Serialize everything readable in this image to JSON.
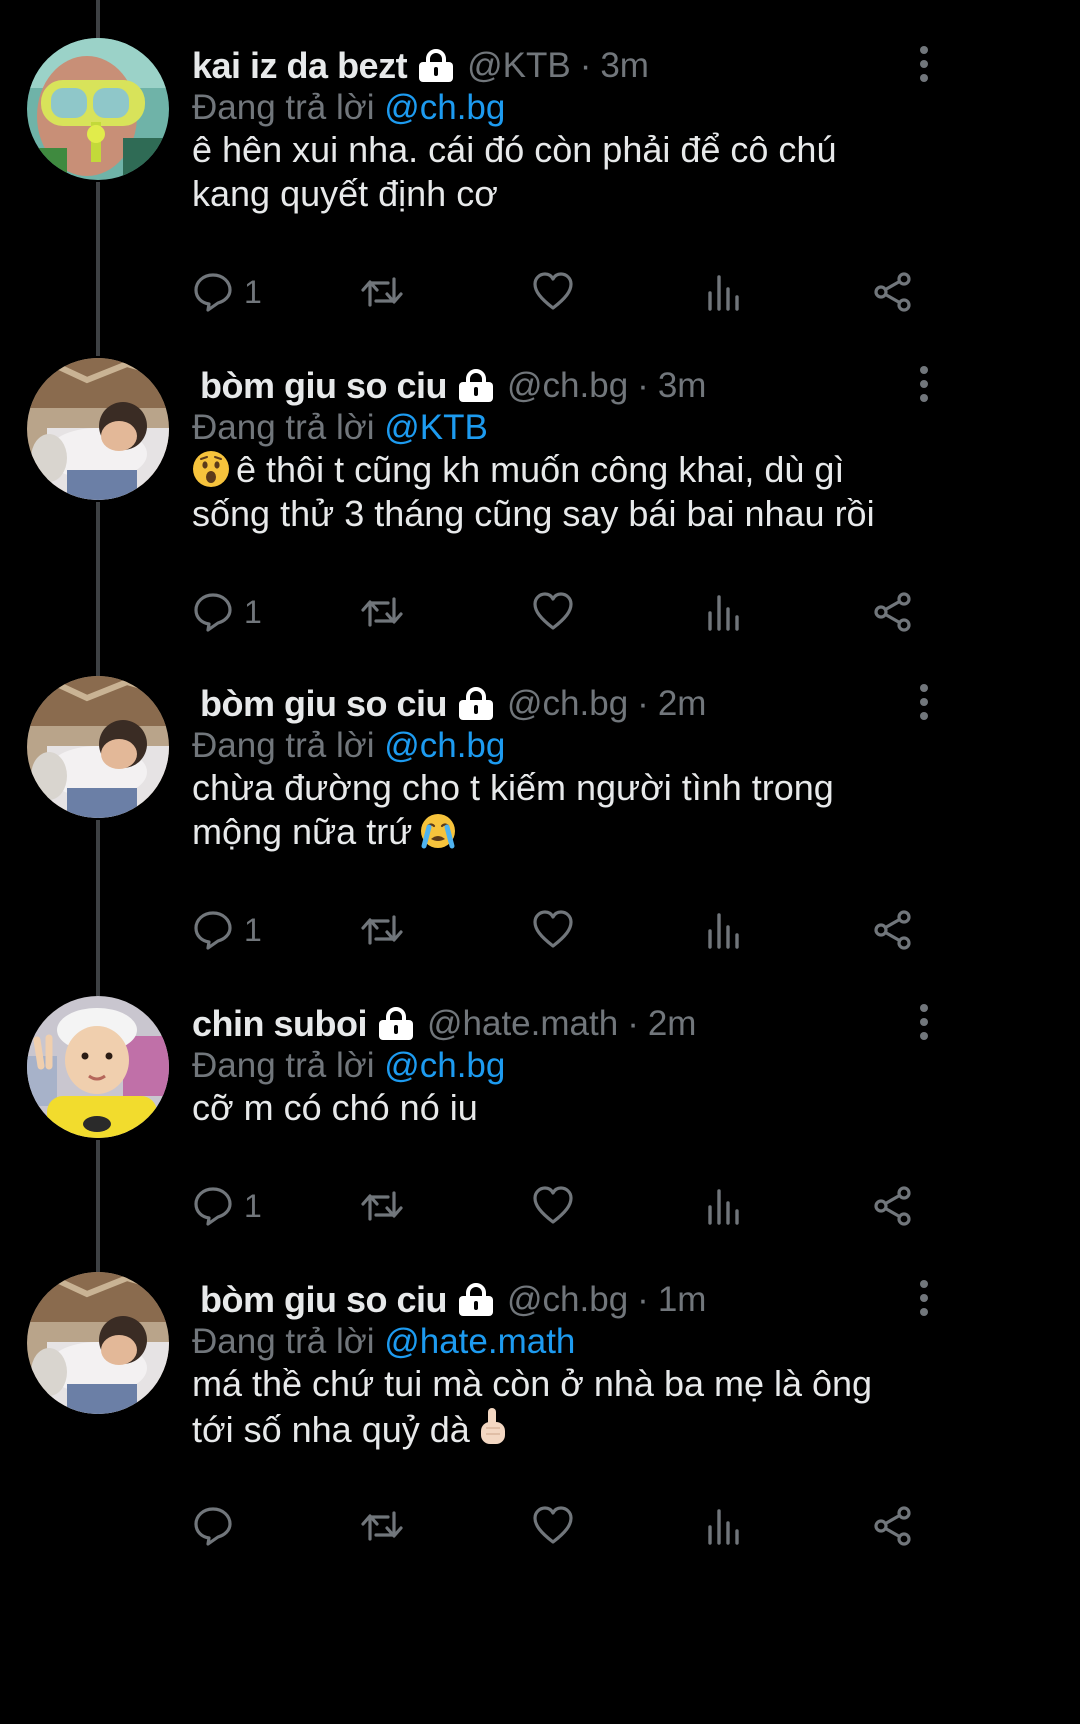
{
  "colors": {
    "background": "#000000",
    "text": "#e7e9ea",
    "muted": "#71767b",
    "mention": "#1d9bf0",
    "thread_line": "#3e4144"
  },
  "icons": {
    "reply": "speech-bubble",
    "retweet": "two-arrows-loop",
    "like": "heart-outline",
    "views": "bar-chart",
    "share": "share-nodes",
    "protected": "padlock",
    "more": "vertical-ellipsis"
  },
  "tweets": [
    {
      "avatar": "snorkel-mask-child",
      "name": "kai iz da bezt",
      "handle": "@KTB",
      "sep": "·",
      "time": "3m",
      "replying_prefix": "Đang trả lời",
      "replying_to": "@ch.bg",
      "text_lines": [
        "ê hên xui nha. cái đó còn phải để cô chú",
        "kang quyết định cơ"
      ],
      "reply_count": "1"
    },
    {
      "avatar": "sleeping-child",
      "name": "bòm giu so ciu",
      "handle": "@ch.bg",
      "sep": "·",
      "time": "3m",
      "replying_prefix": "Đang trả lời",
      "replying_to": "@KTB",
      "text_lines": [
        "ê thôi t cũng kh muốn công khai, dù gì",
        "sống thử 3 tháng cũng say bái bai nhau rồi"
      ],
      "reply_count": "1"
    },
    {
      "avatar": "sleeping-child",
      "name": "bòm giu so ciu",
      "handle": "@ch.bg",
      "sep": "·",
      "time": "2m",
      "replying_prefix": "Đang trả lời",
      "replying_to": "@ch.bg",
      "text_lines": [
        "chừa đường cho t kiếm người tình trong",
        "mộng nữa trứ"
      ],
      "reply_count": "1"
    },
    {
      "avatar": "child-white-hat",
      "name": "chin suboi",
      "handle": "@hate.math",
      "sep": "·",
      "time": "2m",
      "replying_prefix": "Đang trả lời",
      "replying_to": "@ch.bg",
      "text_lines": [
        "cỡ m có chó nó iu"
      ],
      "reply_count": "1"
    },
    {
      "avatar": "sleeping-child",
      "name": "bòm giu so ciu",
      "handle": "@ch.bg",
      "sep": "·",
      "time": "1m",
      "replying_prefix": "Đang trả lời",
      "replying_to": "@hate.math",
      "text_lines": [
        "má thề chứ tui mà còn ở nhà ba mẹ là ông",
        "tới số nha quỷ dà"
      ],
      "reply_count": ""
    }
  ]
}
